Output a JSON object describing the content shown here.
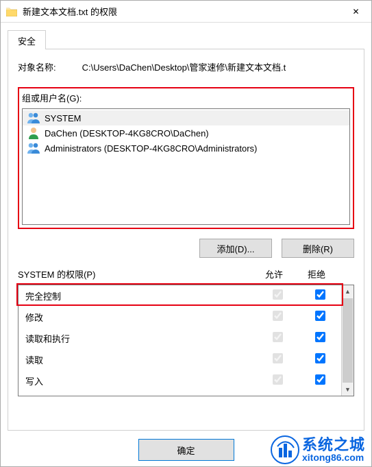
{
  "window": {
    "title": "新建文本文档.txt 的权限",
    "close_glyph": "✕"
  },
  "tab": {
    "label": "安全"
  },
  "object": {
    "label": "对象名称:",
    "path": "C:\\Users\\DaChen\\Desktop\\管家速修\\新建文本文档.t"
  },
  "groups": {
    "label": "组或用户名(G):",
    "items": [
      {
        "name": "SYSTEM",
        "type": "group"
      },
      {
        "name": "DaChen (DESKTOP-4KG8CRO\\DaChen)",
        "type": "user"
      },
      {
        "name": "Administrators (DESKTOP-4KG8CRO\\Administrators)",
        "type": "group"
      }
    ]
  },
  "buttons": {
    "add": "添加(D)...",
    "remove": "删除(R)",
    "ok": "确定"
  },
  "perm": {
    "header": "SYSTEM 的权限(P)",
    "col_allow": "允许",
    "col_deny": "拒绝",
    "rows": [
      {
        "name": "完全控制",
        "allow": true,
        "deny": true
      },
      {
        "name": "修改",
        "allow": true,
        "deny": true
      },
      {
        "name": "读取和执行",
        "allow": true,
        "deny": true
      },
      {
        "name": "读取",
        "allow": true,
        "deny": true
      },
      {
        "name": "写入",
        "allow": true,
        "deny": true
      }
    ]
  },
  "watermark": {
    "cn": "系统之城",
    "url": "xitong86.com"
  }
}
